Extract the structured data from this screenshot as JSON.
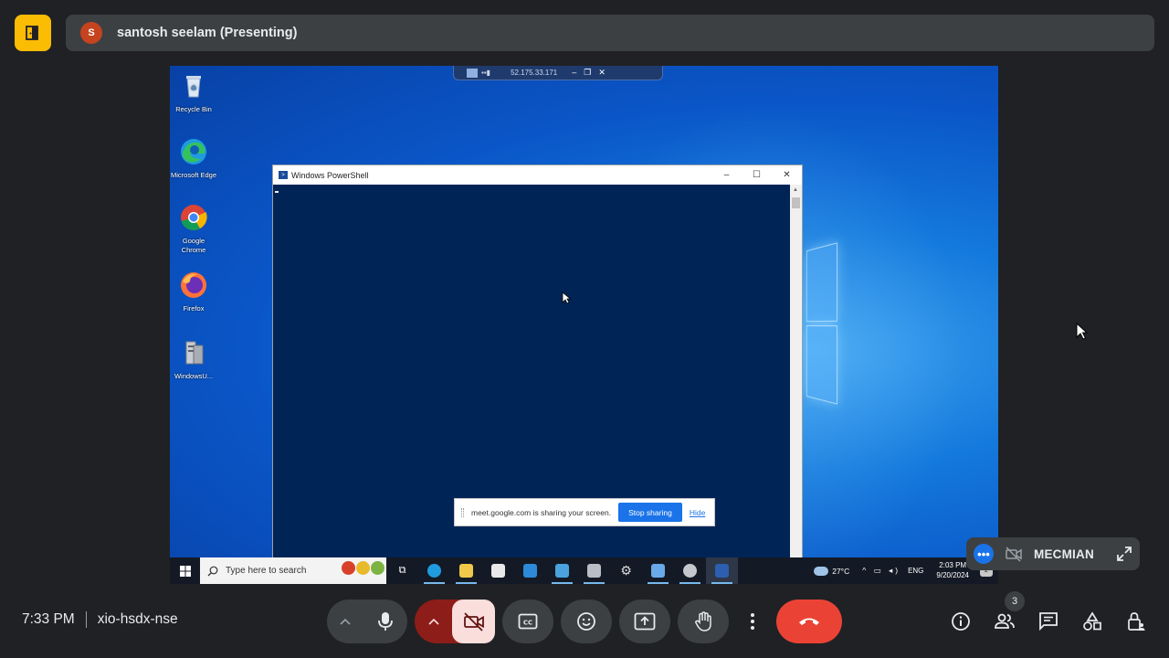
{
  "presenter": {
    "avatar_initial": "S",
    "label": "santosh seelam (Presenting)"
  },
  "remote_desktop": {
    "connection_ip": "52.175.33.171",
    "desktop_icons": [
      {
        "label": "Recycle Bin"
      },
      {
        "label": "Microsoft Edge"
      },
      {
        "label": "Google Chrome"
      },
      {
        "label": "Firefox"
      },
      {
        "label": "WindowsU..."
      }
    ],
    "powershell_window": {
      "title": "Windows PowerShell"
    },
    "share_notice": {
      "message": "meet.google.com is sharing your screen.",
      "stop_label": "Stop sharing",
      "hide_label": "Hide"
    },
    "taskbar": {
      "search_placeholder": "Type here to search",
      "weather": "27°C",
      "language": "ENG",
      "time": "2:03 PM",
      "date": "9/20/2024",
      "notification_count": "2"
    }
  },
  "self_tile": {
    "name": "MECMIAN"
  },
  "meeting": {
    "time": "7:33 PM",
    "code": "xio-hsdx-nse",
    "participant_count": "3"
  },
  "colors": {
    "background": "#202124",
    "surface": "#3c4043",
    "end_call": "#ea4335",
    "home_accent": "#fbbc04",
    "accent_blue": "#1a73e8"
  }
}
